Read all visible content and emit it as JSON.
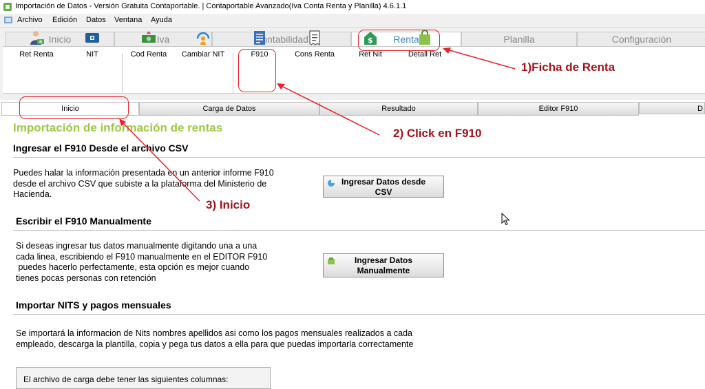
{
  "window": {
    "title": "Importación de Datos - Versión Gratuita Contaportable. | Contaportable Avanzado(Iva Conta Renta y Planilla) 4.6.1.1"
  },
  "menu": {
    "items": [
      "Archivo",
      "Edición",
      "Datos",
      "Ventana",
      "Ayuda"
    ]
  },
  "ribbon": {
    "tabs": [
      "Inicio",
      "Iva",
      "Contabilidad",
      "Renta",
      "Planilla",
      "Configuración"
    ],
    "active_tab": "Renta",
    "tools": [
      {
        "label": "Ret Renta",
        "icon": "person-money-icon"
      },
      {
        "label": "NIT",
        "icon": "id-card-icon"
      },
      {
        "label": "Cod Renta",
        "icon": "cash-icon"
      },
      {
        "label": "Cambiar NIT",
        "icon": "refresh-person-icon"
      },
      {
        "label": "F910",
        "icon": "form-document-icon"
      },
      {
        "label": "Cons Renta",
        "icon": "receipt-icon"
      },
      {
        "label": "Ret Nit",
        "icon": "dollar-house-icon"
      },
      {
        "label": "Detall Ret",
        "icon": "shopping-bag-icon"
      }
    ]
  },
  "subtabs": [
    "Inicio",
    "Carga de Datos",
    "Resultado",
    "Editor F910",
    "D"
  ],
  "content": {
    "heading": "Importación  de información de rentas",
    "section1": {
      "title": "Ingresar el F910 Desde el archivo CSV",
      "text": [
        "Puedes halar  la información presentada en un anterior informe F910",
        "desde el archivo CSV que subiste a la plataforma del Ministerio de",
        "Hacienda."
      ],
      "button": [
        "Ingresar Datos desde",
        "CSV"
      ]
    },
    "section2": {
      "title": "Escribir  el F910 Manualmente",
      "text": [
        "Si deseas ingresar tus datos manualmente digitando una a una",
        "cada linea, escribiendo el F910  manualmente en el EDITOR F910",
        " puedes hacerlo perfectamente, esta opción es mejor cuando",
        "tienes pocas personas con retención"
      ],
      "button": [
        "Ingresar Datos",
        "Manualmente"
      ]
    },
    "section3": {
      "title": "Importar NITS y pagos mensuales",
      "text": [
        "Se importará la informacion de Nits nombres apellidos  asi como los pagos mensuales realizados a cada",
        "empleado, descarga la plantilla, copia y pega tus datos a ella para que puedas importarla correctamente"
      ]
    },
    "footer_box": "El archivo de carga debe tener las siguientes columnas:"
  },
  "annotations": [
    "1)Ficha de Renta",
    "2) Click en F910",
    "3) Inicio"
  ],
  "colors": {
    "heading": "#9cc945",
    "annotation": "#a3121b",
    "ring": "#e8202a",
    "active_tab": "#3b7fc4"
  }
}
